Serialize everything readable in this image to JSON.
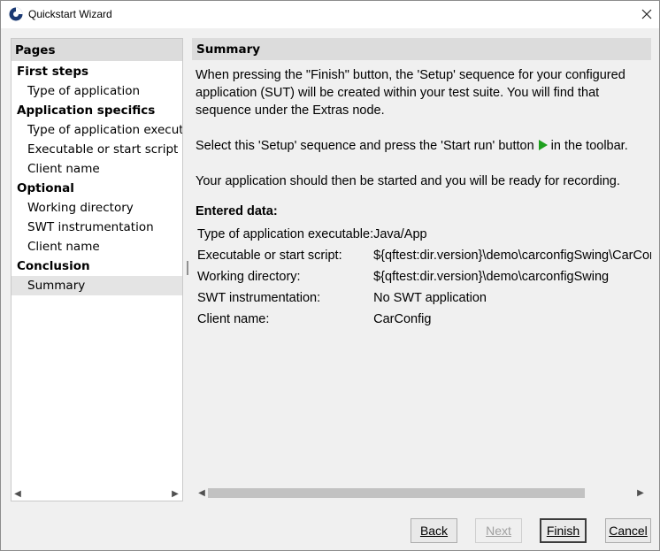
{
  "window": {
    "title": "Quickstart Wizard"
  },
  "pages": {
    "header": "Pages",
    "groups": [
      {
        "label": "First steps",
        "items": [
          "Type of application"
        ]
      },
      {
        "label": "Application specifics",
        "items": [
          "Type of application executable",
          "Executable or start script",
          "Client name"
        ]
      },
      {
        "label": "Optional",
        "items": [
          "Working directory",
          "SWT instrumentation",
          "Client name"
        ]
      },
      {
        "label": "Conclusion",
        "items": [
          "Summary"
        ]
      }
    ],
    "selected": "Summary"
  },
  "summary": {
    "header": "Summary",
    "para1": [
      "When pressing the \"Finish\" button, the 'Setup' sequence for your configured",
      "application (SUT) will be created within your test suite. You will find that",
      "sequence under the Extras node."
    ],
    "para2_before": "Select this 'Setup' sequence and press the 'Start run' button",
    "para2_after": "in the toolbar.",
    "para3": "Your application should then be started and you will be ready for recording.",
    "entered_title": "Entered data:",
    "rows": [
      {
        "key": "Type of application executable:",
        "value": "Java/App"
      },
      {
        "key": "Executable or start script:",
        "value": "${qftest:dir.version}\\demo\\carconfigSwing\\CarConfig"
      },
      {
        "key": "Working directory:",
        "value": "${qftest:dir.version}\\demo\\carconfigSwing"
      },
      {
        "key": "SWT instrumentation:",
        "value": "No SWT application"
      },
      {
        "key": "Client name:",
        "value": "CarConfig"
      }
    ]
  },
  "buttons": {
    "back": "Back",
    "next": "Next",
    "finish": "Finish",
    "cancel": "Cancel"
  },
  "colors": {
    "play": "#1ea01e",
    "app_icon": "#1b3a73"
  }
}
